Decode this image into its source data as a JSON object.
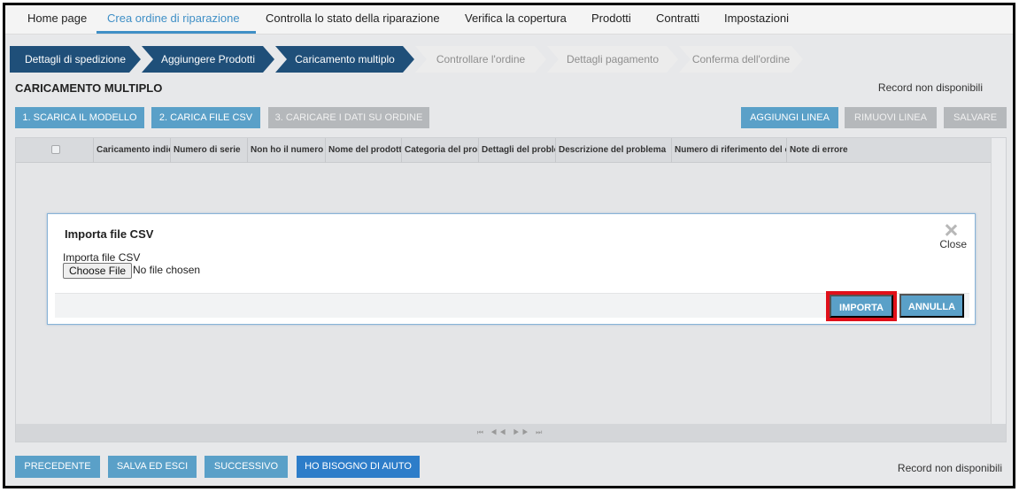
{
  "top_nav": {
    "items": [
      {
        "label": "Home page"
      },
      {
        "label": "Crea ordine di riparazione",
        "active": true
      },
      {
        "label": "Controlla lo stato della riparazione"
      },
      {
        "label": "Verifica la copertura"
      },
      {
        "label": "Prodotti"
      },
      {
        "label": "Contratti"
      },
      {
        "label": "Impostazioni"
      }
    ]
  },
  "wizard": {
    "steps": [
      {
        "label": "Dettagli di spedizione",
        "state": "done"
      },
      {
        "label": "Aggiungere Prodotti",
        "state": "done"
      },
      {
        "label": "Caricamento multiplo",
        "state": "current"
      },
      {
        "label": "Controllare l'ordine",
        "state": "todo"
      },
      {
        "label": "Dettagli pagamento",
        "state": "todo"
      },
      {
        "label": "Conferma dell'ordine",
        "state": "todo"
      }
    ]
  },
  "section": {
    "title": "CARICAMENTO MULTIPLO",
    "record_status": "Record non disponibili"
  },
  "actions": {
    "download_template": "1. SCARICA IL MODELLO",
    "upload_csv": "2. CARICA FILE CSV",
    "load_to_order": "3. CARICARE I DATI SU ORDINE",
    "add_line": "AGGIUNGI LINEA",
    "remove_line": "RIMUOVI LINEA",
    "save": "SALVARE"
  },
  "grid": {
    "columns": [
      "Caricamento indic",
      "Numero di serie",
      "Non ho il numero c",
      "Nome del prodotto",
      "Categoria del prob",
      "Dettagli del proble",
      "Descrizione del problema",
      "Numero di riferimento del cl",
      "Note di errore"
    ],
    "pager": "⏮ ◀◀ ▶▶ ⏭"
  },
  "modal": {
    "title": "Importa file CSV",
    "close_label": "Close",
    "file_label": "Importa file CSV",
    "choose_file": "Choose File",
    "no_file": "No file chosen",
    "import_button": "IMPORTA",
    "cancel_button": "ANNULLA"
  },
  "footer": {
    "previous": "PRECEDENTE",
    "save_exit": "SALVA ED ESCI",
    "next": "SUCCESSIVO",
    "help": "HO BISOGNO DI AIUTO",
    "record_status": "Record non disponibili"
  },
  "colors": {
    "accent": "#3f8fc6",
    "step_done": "#1f4f79",
    "button_blue": "#5aa0c8",
    "button_gray": "#b5b8bb",
    "help_button": "#2d7dc9",
    "highlight_border": "#e0101a"
  }
}
